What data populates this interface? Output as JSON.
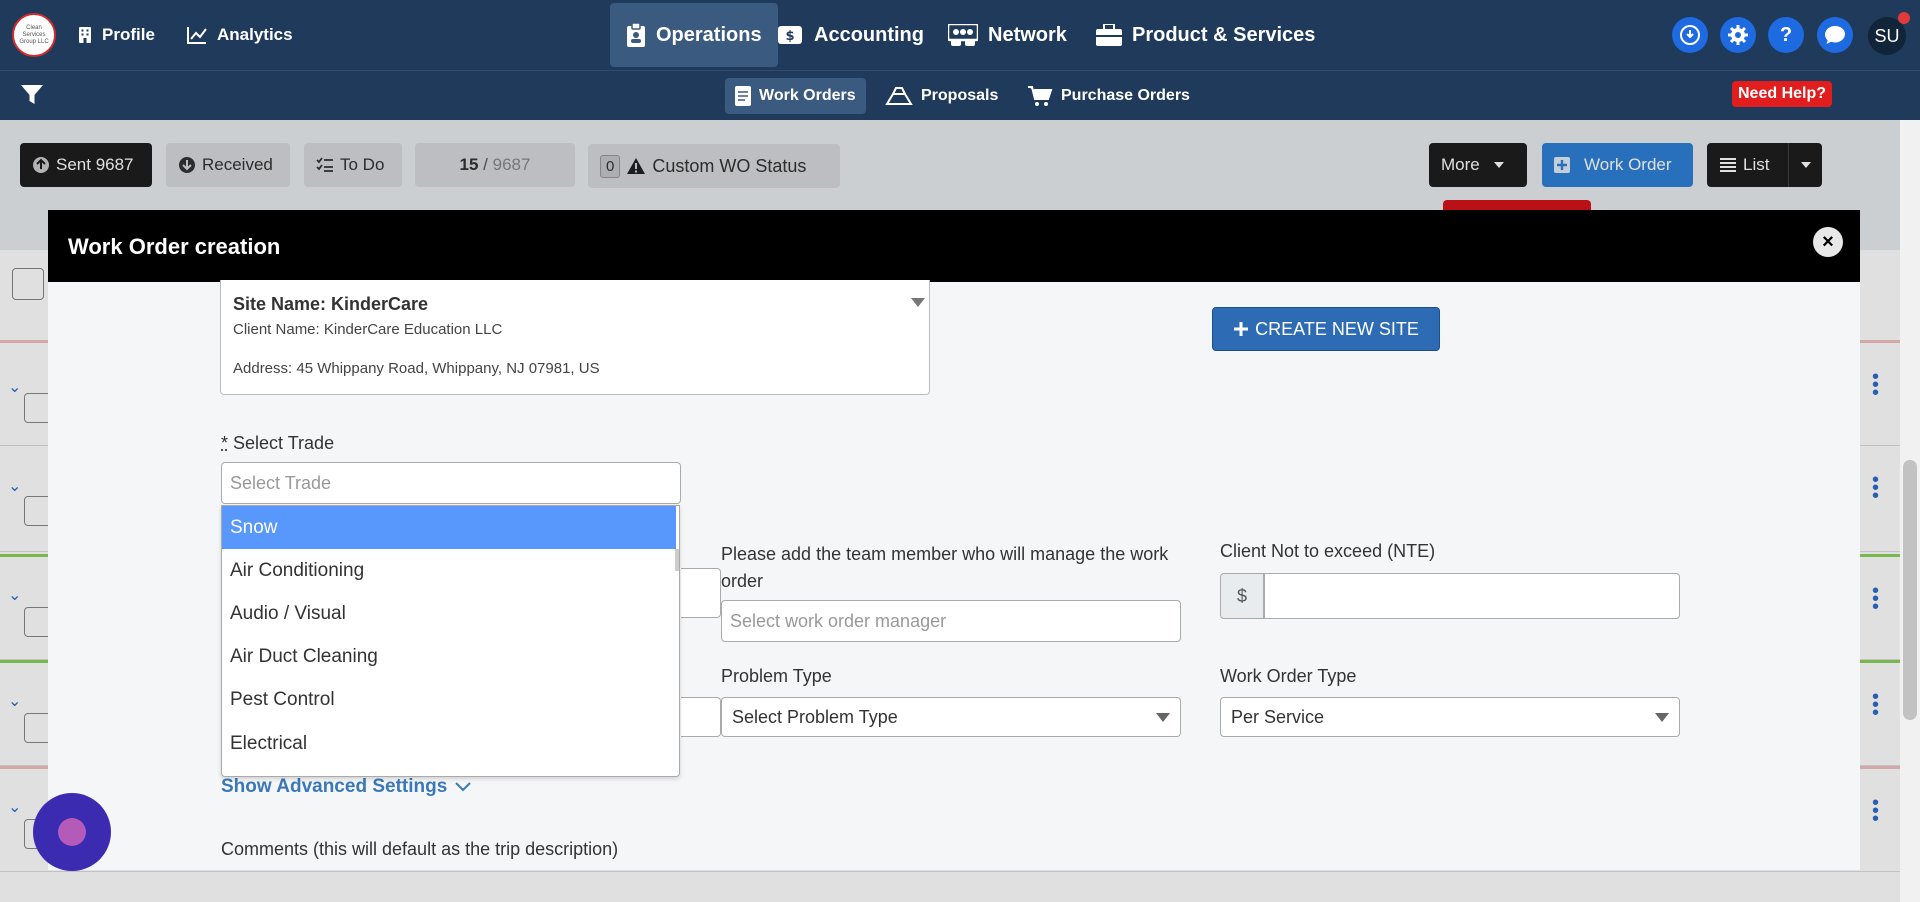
{
  "topnav": {
    "logo_text": "Clean Services Group LLC",
    "items": [
      {
        "label": "Profile",
        "icon": "building-icon"
      },
      {
        "label": "Analytics",
        "icon": "chart-line-icon"
      },
      {
        "label": "Operations",
        "icon": "clipboard-icon"
      },
      {
        "label": "Accounting",
        "icon": "money-icon"
      },
      {
        "label": "Network",
        "icon": "network-icon"
      },
      {
        "label": "Product & Services",
        "icon": "briefcase-icon"
      }
    ],
    "help_glyph": "?",
    "avatar": "SU"
  },
  "subnav": {
    "items": [
      {
        "label": "Work Orders"
      },
      {
        "label": "Proposals"
      },
      {
        "label": "Purchase Orders"
      }
    ],
    "need_help": "Need Help?"
  },
  "toolbar": {
    "sent": "Sent 9687",
    "received": "Received",
    "todo": "To Do",
    "count_current": "15",
    "count_sep": " / ",
    "count_total": "9687",
    "custom_count": "0",
    "custom_label": "Custom WO Status",
    "more": "More",
    "work_order": "Work Order",
    "list": "List"
  },
  "modal": {
    "title": "Work Order creation",
    "close_glyph": "×",
    "site": {
      "name": "Site Name: KinderCare",
      "client": "Client Name: KinderCare Education LLC",
      "address": "Address: 45 Whippany Road, Whippany, NJ 07981, US"
    },
    "create_site": "CREATE NEW SITE",
    "trade_required": "*",
    "trade_label": " Select Trade",
    "trade_placeholder": "Select Trade",
    "trade_options": [
      "Snow",
      "Air Conditioning",
      "Audio / Visual",
      "Air Duct Cleaning",
      "Pest Control",
      "Electrical"
    ],
    "manager_label": "Please add the team member who will manage the work order",
    "manager_placeholder": "Select work order manager",
    "nte_label": "Client Not to exceed (NTE)",
    "nte_prefix": "$",
    "problem_label": "Problem Type",
    "problem_value": "Select Problem Type",
    "wo_type_label": "Work Order Type",
    "wo_type_value": "Per Service",
    "advanced": "Show Advanced Settings",
    "comments_label": "Comments (this will default as the trip description)"
  },
  "colors": {
    "nav_bg": "#1f3a5a",
    "accent_blue": "#2e7fd6",
    "selected_option": "#5897fb",
    "need_help_red": "#e21d1d"
  }
}
